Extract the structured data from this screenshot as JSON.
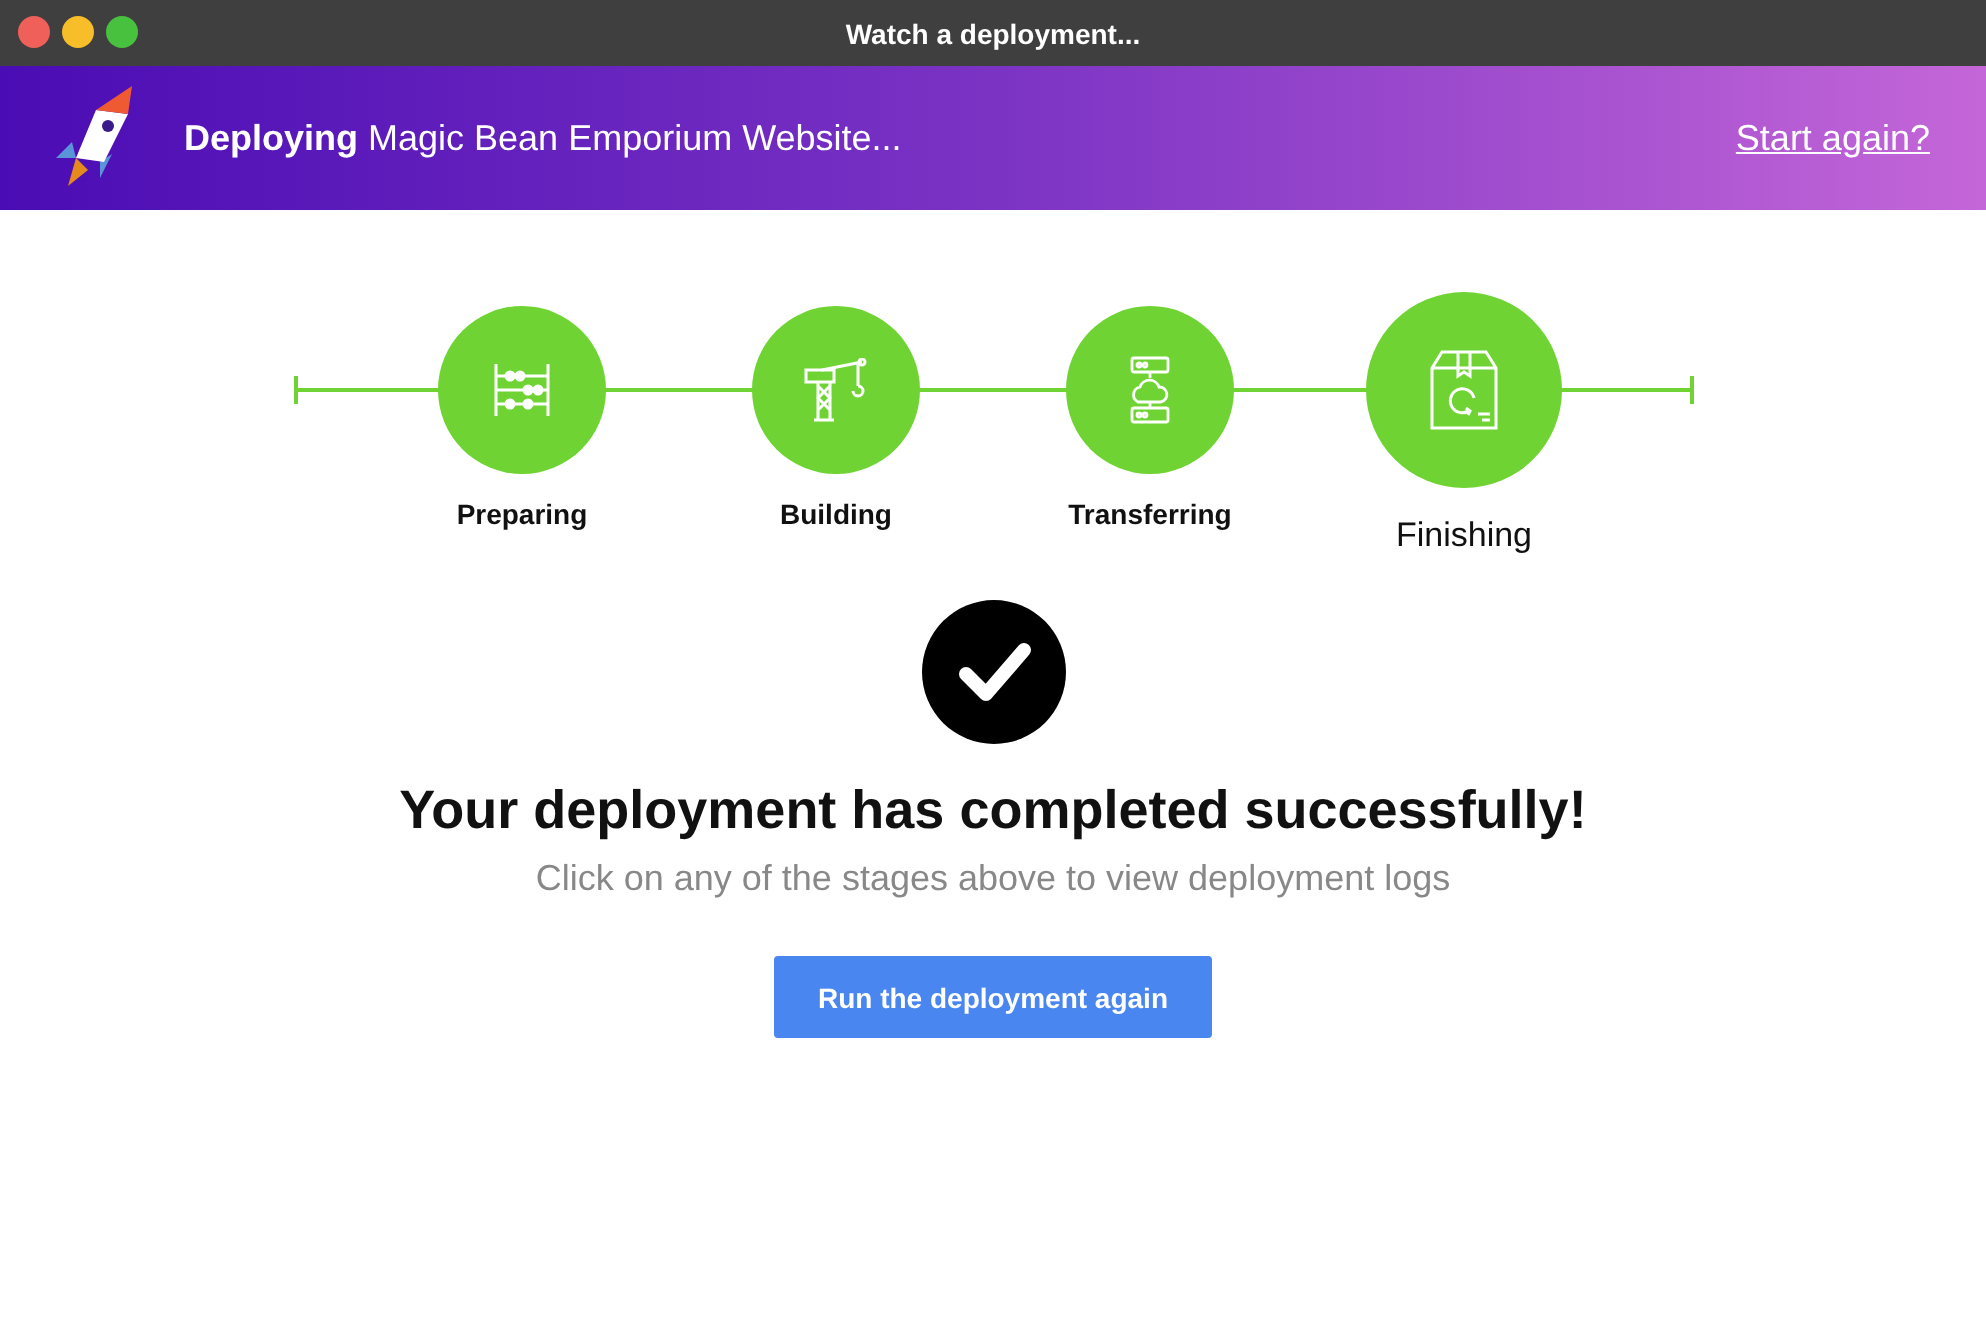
{
  "window": {
    "title": "Watch a deployment..."
  },
  "header": {
    "text": "**Deploying** Magic Bean Emporium Website...",
    "link": "Start again?"
  },
  "stages": [
    {
      "label": "Preparing",
      "selected": false
    },
    {
      "label": "Building",
      "selected": false
    },
    {
      "label": "Transferring",
      "selected": false
    },
    {
      "label": "Finishing",
      "selected": true
    }
  ],
  "result": {
    "heading": "Your deployment has completed successfully!",
    "hint": "Click on any of the stages above to view deployment logs",
    "button": "Run the deployment again"
  }
}
